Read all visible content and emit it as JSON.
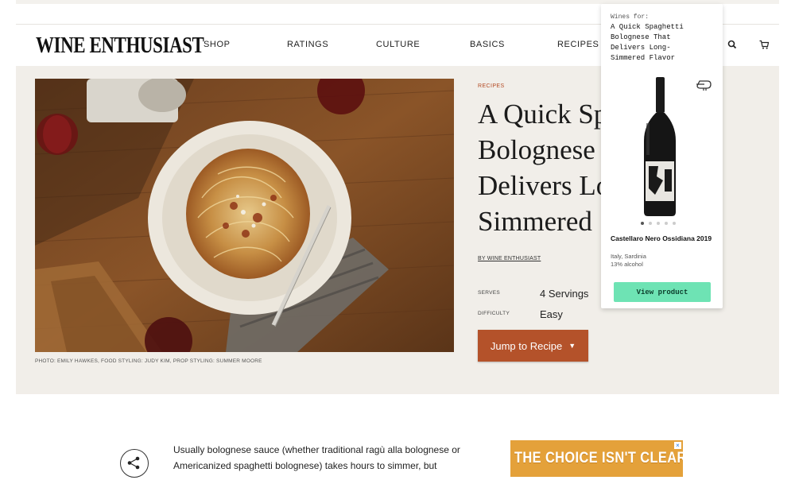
{
  "header": {
    "logo": "WINE ENTHUSIAST",
    "nav": [
      {
        "label": "SHOP"
      },
      {
        "label": "RATINGS"
      },
      {
        "label": "CULTURE"
      },
      {
        "label": "BASICS"
      },
      {
        "label": "RECIPES"
      }
    ],
    "icons": [
      "search-icon",
      "cart-icon"
    ]
  },
  "hero": {
    "photo_credit": "PHOTO: EMILY HAWKES, FOOD STYLING: JUDY KIM, PROP STYLING: SUMMER MOORE",
    "eyebrow": "RECIPES",
    "title_visible": "A Quick Sp\nBolognese\nDelivers Lo\nSimmered",
    "byline": "BY WINE ENTHUSIAST",
    "meta": [
      {
        "label": "SERVES",
        "value": "4 Servings"
      },
      {
        "label": "DIFFICULTY",
        "value": "Easy"
      }
    ],
    "jump_label": "Jump to Recipe"
  },
  "popup": {
    "wines_for": "Wines for:",
    "title": "A Quick Spaghetti\nBolognese That\nDelivers Long-\nSimmered Flavor",
    "carousel": {
      "count": 5,
      "active_index": 0
    },
    "product_name": "Castellaro Nero Ossidiana 2019",
    "region": "Italy, Sardinia",
    "alcohol": "13% alcohol",
    "button": "View product"
  },
  "article": {
    "body": "Usually bolognese sauce (whether traditional ragù alla bolognese or Americanized spaghetti bolognese) takes hours to simmer, but"
  },
  "ad": {
    "text": "THE CHOICE ISN'T CLEAR.",
    "close": "×"
  },
  "colors": {
    "accent": "#b4522a",
    "hero_bg": "#f1eee9",
    "popup_button": "#6ee3b4",
    "ad_bg": "#e4a13a"
  }
}
